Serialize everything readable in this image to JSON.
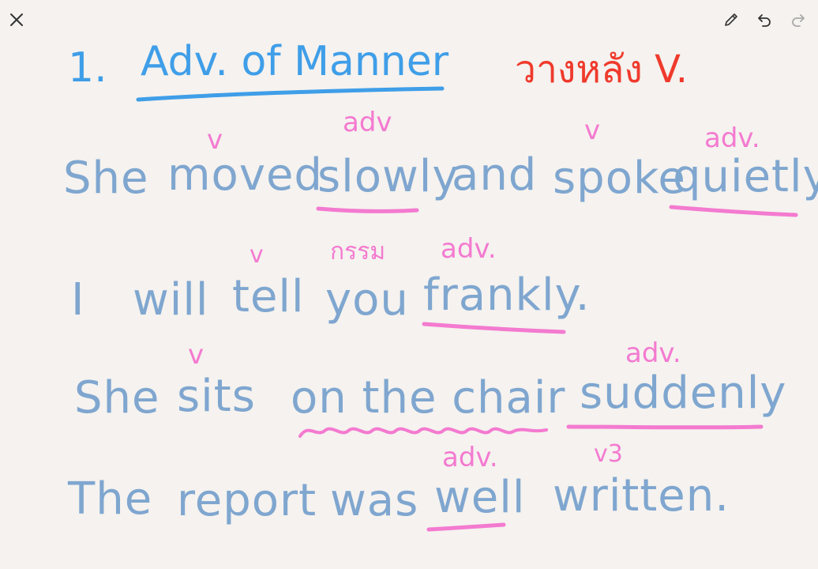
{
  "toolbar": {
    "close_icon": "close-icon",
    "pencil_icon": "pencil-icon",
    "undo_icon": "undo-icon",
    "redo_icon": "redo-icon"
  },
  "colors": {
    "background": "#f5f2ef",
    "blue_ink": "#7fa6cf",
    "title_ink": "#3f9ee8",
    "red_ink": "#ef3a2c",
    "pink_ink": "#f47ad0",
    "toolbar_icon": "#333333",
    "toolbar_icon_disabled": "#aaaaaa"
  },
  "note": {
    "heading": {
      "number": "1.",
      "title": "Adv. of Manner",
      "remark": "วางหลัง V."
    },
    "line1": {
      "text_she": "She",
      "text_moved": "moved",
      "text_slowly": "slowly",
      "text_and": "and",
      "text_spoke": "spoke",
      "text_quietly": "quietly.",
      "mark_v1": "v",
      "mark_adv1": "adv",
      "mark_v2": "v",
      "mark_adv2": "adv."
    },
    "line2": {
      "text_i": "I",
      "text_will": "will",
      "text_tell": "tell",
      "text_you": "you",
      "text_frankly": "frankly.",
      "mark_v": "v",
      "mark_grammar": "กรรม",
      "mark_adv": "adv."
    },
    "line3": {
      "text_she": "She",
      "text_sits": "sits",
      "text_on_the_chair": "on the chair",
      "text_suddenly": "suddenly",
      "mark_v": "v",
      "mark_adv": "adv."
    },
    "line4": {
      "text_the": "The",
      "text_report": "report",
      "text_was": "was",
      "text_well": "well",
      "text_written": "written.",
      "mark_adv": "adv.",
      "mark_v3": "v3"
    }
  }
}
